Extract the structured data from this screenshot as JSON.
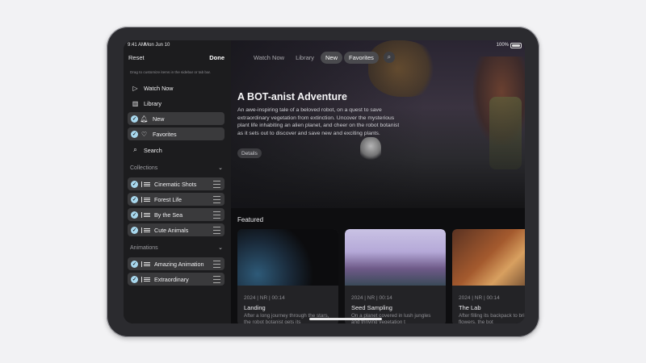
{
  "status_bar": {
    "time": "9:41 AM",
    "date": "Mon Jun 10",
    "battery": "100%"
  },
  "sidebar": {
    "reset_label": "Reset",
    "done_label": "Done",
    "hint": "Drag to customize items in the sidebar or tab bar.",
    "items": [
      {
        "label": "Watch Now",
        "icon": "play-icon",
        "checked": false
      },
      {
        "label": "Library",
        "icon": "library-icon",
        "checked": false
      },
      {
        "label": "New",
        "icon": "bell-icon",
        "checked": true
      },
      {
        "label": "Favorites",
        "icon": "heart-icon",
        "checked": true
      },
      {
        "label": "Search",
        "icon": "search-icon",
        "checked": false
      }
    ],
    "collections_header": "Collections",
    "collections": [
      {
        "label": "Cinematic Shots",
        "checked": true
      },
      {
        "label": "Forest Life",
        "checked": true
      },
      {
        "label": "By the Sea",
        "checked": true
      },
      {
        "label": "Cute Animals",
        "checked": true
      }
    ],
    "animations_header": "Animations",
    "animations": [
      {
        "label": "Amazing Animation",
        "checked": true
      },
      {
        "label": "Extraordinary",
        "checked": true
      }
    ]
  },
  "top_nav": {
    "tabs": [
      {
        "label": "Watch Now",
        "state": "muted"
      },
      {
        "label": "Library",
        "state": "muted"
      },
      {
        "label": "New",
        "state": "active"
      },
      {
        "label": "Favorites",
        "state": "pinned"
      }
    ],
    "search_icon": "search-icon"
  },
  "hero": {
    "title": "A BOT-anist Adventure",
    "description": "An awe-inspiring tale of a beloved robot, on a quest to save extraordinary vegetation from extinction. Uncover the mysterious plant life inhabiting an alien planet, and cheer on the robot botanist as it sets out to discover and save new and exciting plants.",
    "details_label": "Details"
  },
  "featured": {
    "heading": "Featured",
    "cards": [
      {
        "meta": "2024 | NR | 00:14",
        "title": "Landing",
        "description": "After a long journey through the stars, the robot botanist gets its"
      },
      {
        "meta": "2024 | NR | 00:14",
        "title": "Seed Sampling",
        "description": "On a planet covered in lush jungles and thriving vegetation t"
      },
      {
        "meta": "2024 | NR | 00:14",
        "title": "The Lab",
        "description": "After filling its backpack to brim with flowers, the bot"
      }
    ]
  },
  "colors": {
    "accent_check": "#a8d8ee",
    "sidebar_bg": "#1c1c1e",
    "selected_row": "#3a3a3c"
  }
}
